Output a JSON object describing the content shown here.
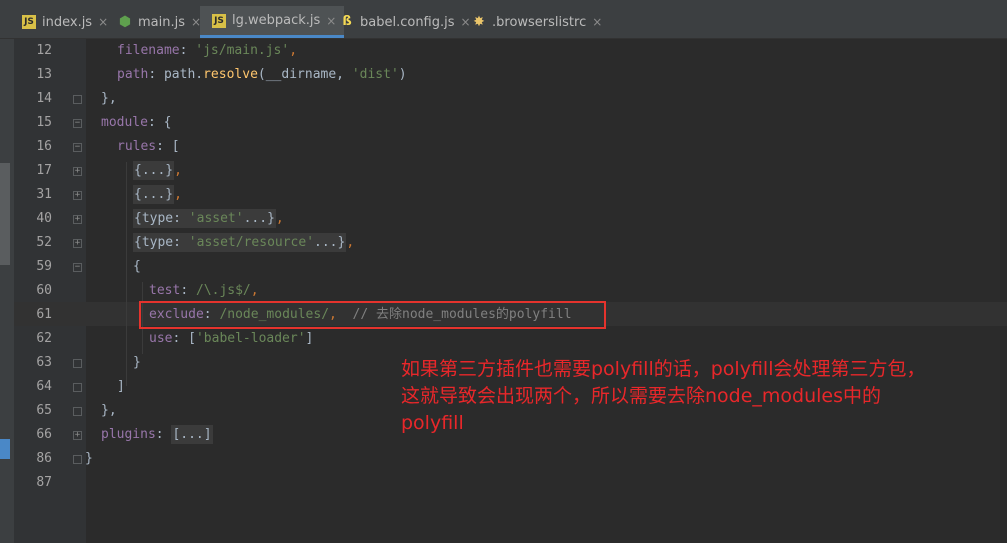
{
  "tabs": [
    {
      "label": "index.js",
      "icon": "js-file-icon",
      "close": "×"
    },
    {
      "label": "main.js",
      "icon": "nodejs-icon",
      "close": "×"
    },
    {
      "label": "lg.webpack.js",
      "icon": "js-file-icon",
      "close": "×",
      "active": true
    },
    {
      "label": "babel.config.js",
      "icon": "babel-icon",
      "close": "×"
    },
    {
      "label": ".browserslistrc",
      "icon": "browserslist-icon",
      "close": "×"
    }
  ],
  "line_numbers": [
    "12",
    "13",
    "14",
    "15",
    "16",
    "17",
    "31",
    "40",
    "52",
    "59",
    "60",
    "61",
    "62",
    "63",
    "64",
    "65",
    "66",
    "86",
    "87"
  ],
  "code": {
    "l12": [
      "filename",
      ": ",
      "'js/main.js'",
      ","
    ],
    "l13": [
      "path",
      ": path.",
      "resolve",
      "(__dirname, ",
      "'dist'",
      ")"
    ],
    "l14": [
      "},"
    ],
    "l15": [
      "module",
      ": {"
    ],
    "l16": [
      "rules",
      ": ["
    ],
    "l17": [
      "{...}",
      ","
    ],
    "l31": [
      "{...}",
      ","
    ],
    "l40": [
      "{type: ",
      "'asset'",
      "...}",
      ","
    ],
    "l52": [
      "{type: ",
      "'asset/resource'",
      "...}",
      ","
    ],
    "l59": [
      "{"
    ],
    "l60": [
      "test",
      ": ",
      "/\\.js$/",
      ","
    ],
    "l61": [
      "exclude",
      ": ",
      "/node_modules/",
      ",",
      "// 去除node_modules的polyfill"
    ],
    "l62": [
      "use",
      ": [",
      "'babel-loader'",
      "]"
    ],
    "l63": [
      "}"
    ],
    "l64": [
      "]"
    ],
    "l65": [
      "},"
    ],
    "l66": [
      "plugins",
      ": ",
      "[...]"
    ],
    "l86": [
      "}"
    ]
  },
  "annotation": {
    "line1": "如果第三方插件也需要polyfill的话，polyfill会处理第三方包，",
    "line2": "这就导致会出现两个，所以需要去除node_modules中的",
    "line3": "polyfill"
  },
  "colors": {
    "keyword": "#cc7832",
    "string": "#6a8759",
    "property": "#9876aa",
    "function": "#ffc66d",
    "comment": "#808080",
    "highlight_box": "#e5332d",
    "annotation_text": "#e8272a"
  }
}
